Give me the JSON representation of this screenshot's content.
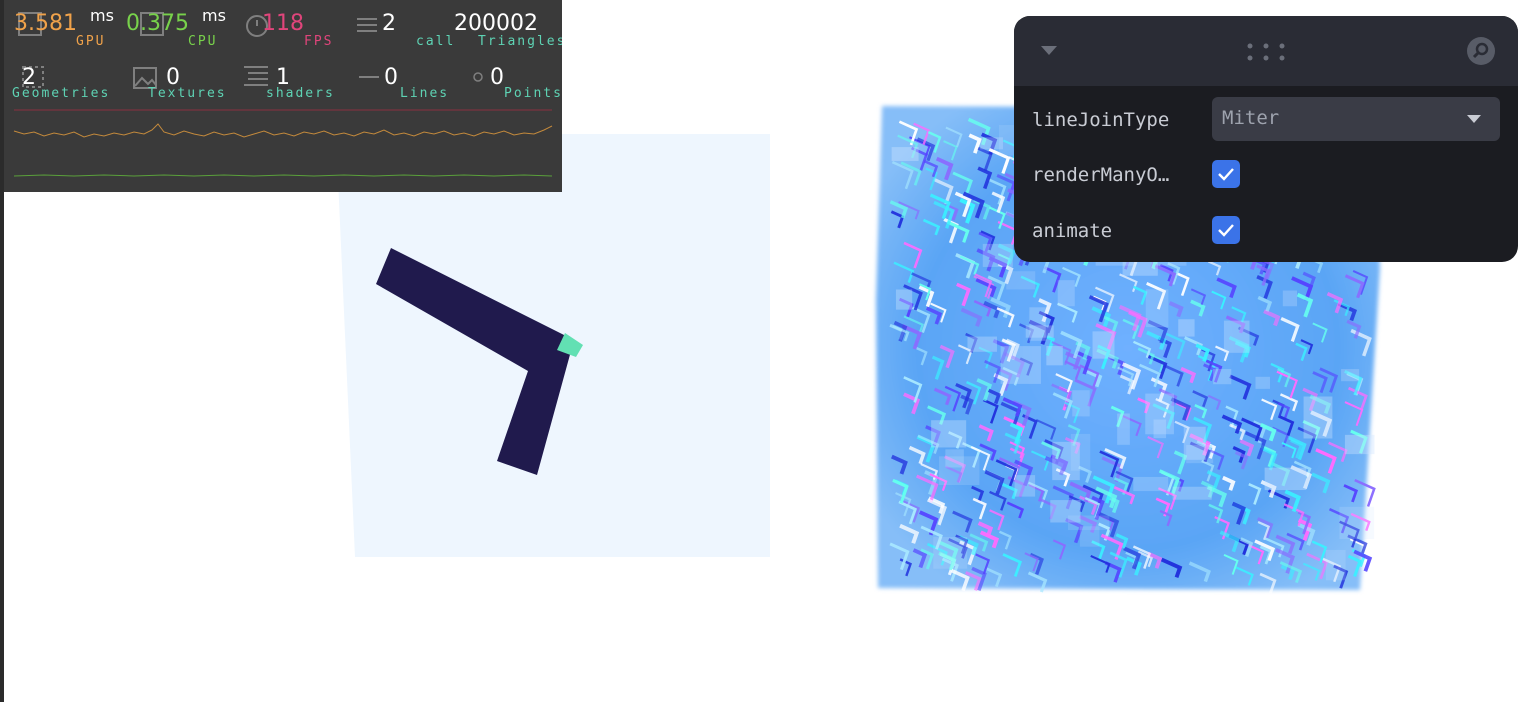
{
  "stats": {
    "gpu": {
      "value": "3.581",
      "unit": "ms",
      "label": "GPU",
      "color": "#f0a24a"
    },
    "cpu": {
      "value": "0.375",
      "unit": "ms",
      "label": "CPU",
      "color": "#78d24b"
    },
    "fps": {
      "value": "118",
      "label": "FPS",
      "color": "#e0457b"
    },
    "calls": {
      "value": "2",
      "label": "call"
    },
    "triangles": {
      "value": "200002",
      "label": "Triangles"
    },
    "geometries": {
      "value": "2",
      "label": "Geometries"
    },
    "textures": {
      "value": "0",
      "label": "Textures"
    },
    "shaders": {
      "value": "1",
      "label": "shaders"
    },
    "lines": {
      "value": "0",
      "label": "Lines"
    },
    "points": {
      "value": "0",
      "label": "Points"
    },
    "label_color": "#5ed3b4"
  },
  "gui": {
    "header_icons": [
      "caret-down-icon",
      "drag-handle-icon",
      "search-icon"
    ],
    "controls": [
      {
        "label": "lineJoinType",
        "type": "select",
        "value": "Miter"
      },
      {
        "label": "renderManyO…",
        "type": "checkbox",
        "checked": true
      },
      {
        "label": "animate",
        "type": "checkbox",
        "checked": true
      }
    ]
  },
  "colors": {
    "panel_bg": "#1b1c21",
    "header_bg": "#2a2c35",
    "checkbox": "#3b73e8",
    "line_fill": "#201a4d",
    "line_join": "#62e0b3",
    "plane": "#eef6fe"
  }
}
